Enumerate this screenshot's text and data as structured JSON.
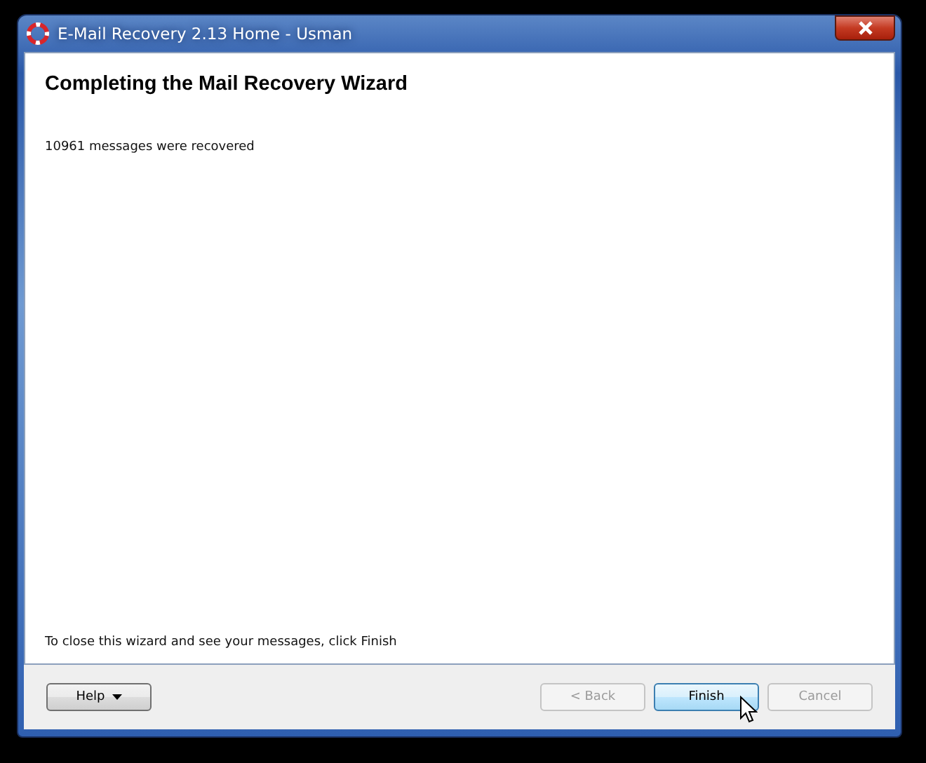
{
  "window": {
    "title": "E-Mail Recovery 2.13 Home - Usman"
  },
  "heading": "Completing the Mail Recovery Wizard",
  "message": "10961 messages were recovered",
  "instruction": "To close this wizard and see your messages, click Finish",
  "buttons": [
    {
      "label": "Help",
      "kind": "menu",
      "disabled": false,
      "hovered": false
    },
    {
      "label": "< Back",
      "kind": "plain",
      "disabled": true,
      "hovered": false
    },
    {
      "label": "Finish",
      "kind": "plain",
      "disabled": false,
      "hovered": true
    },
    {
      "label": "Cancel",
      "kind": "plain",
      "disabled": true,
      "hovered": false
    }
  ]
}
